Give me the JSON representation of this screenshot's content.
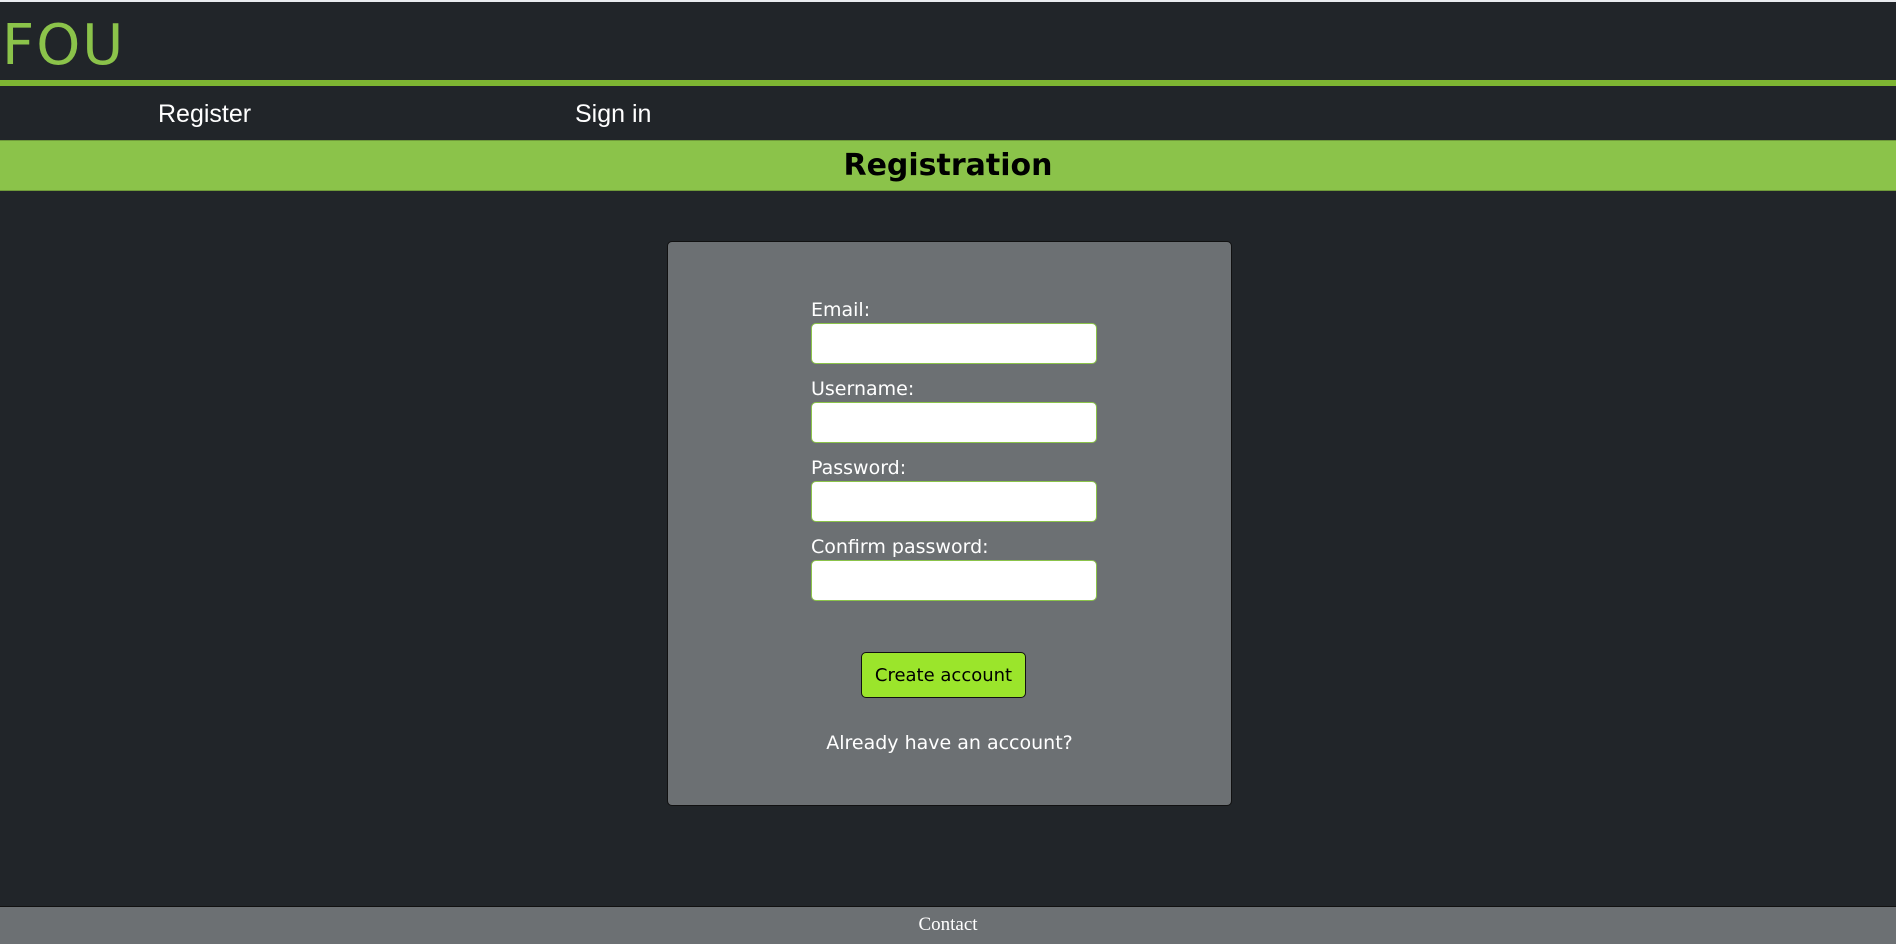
{
  "brand": {
    "logo_text": "FOU",
    "accent_color": "#8bc34a",
    "button_color": "#9be52b",
    "background_color": "#212529",
    "card_color": "#6c7073"
  },
  "nav": {
    "register_label": "Register",
    "signin_label": "Sign in"
  },
  "banner": {
    "title": "Registration"
  },
  "form": {
    "email_label": "Email:",
    "email_value": "",
    "username_label": "Username:",
    "username_value": "",
    "password_label": "Password:",
    "password_value": "",
    "confirm_label": "Confirm password:",
    "confirm_value": "",
    "submit_label": "Create account",
    "signin_prompt": "Already have an account?"
  },
  "footer": {
    "contact_label": "Contact"
  }
}
